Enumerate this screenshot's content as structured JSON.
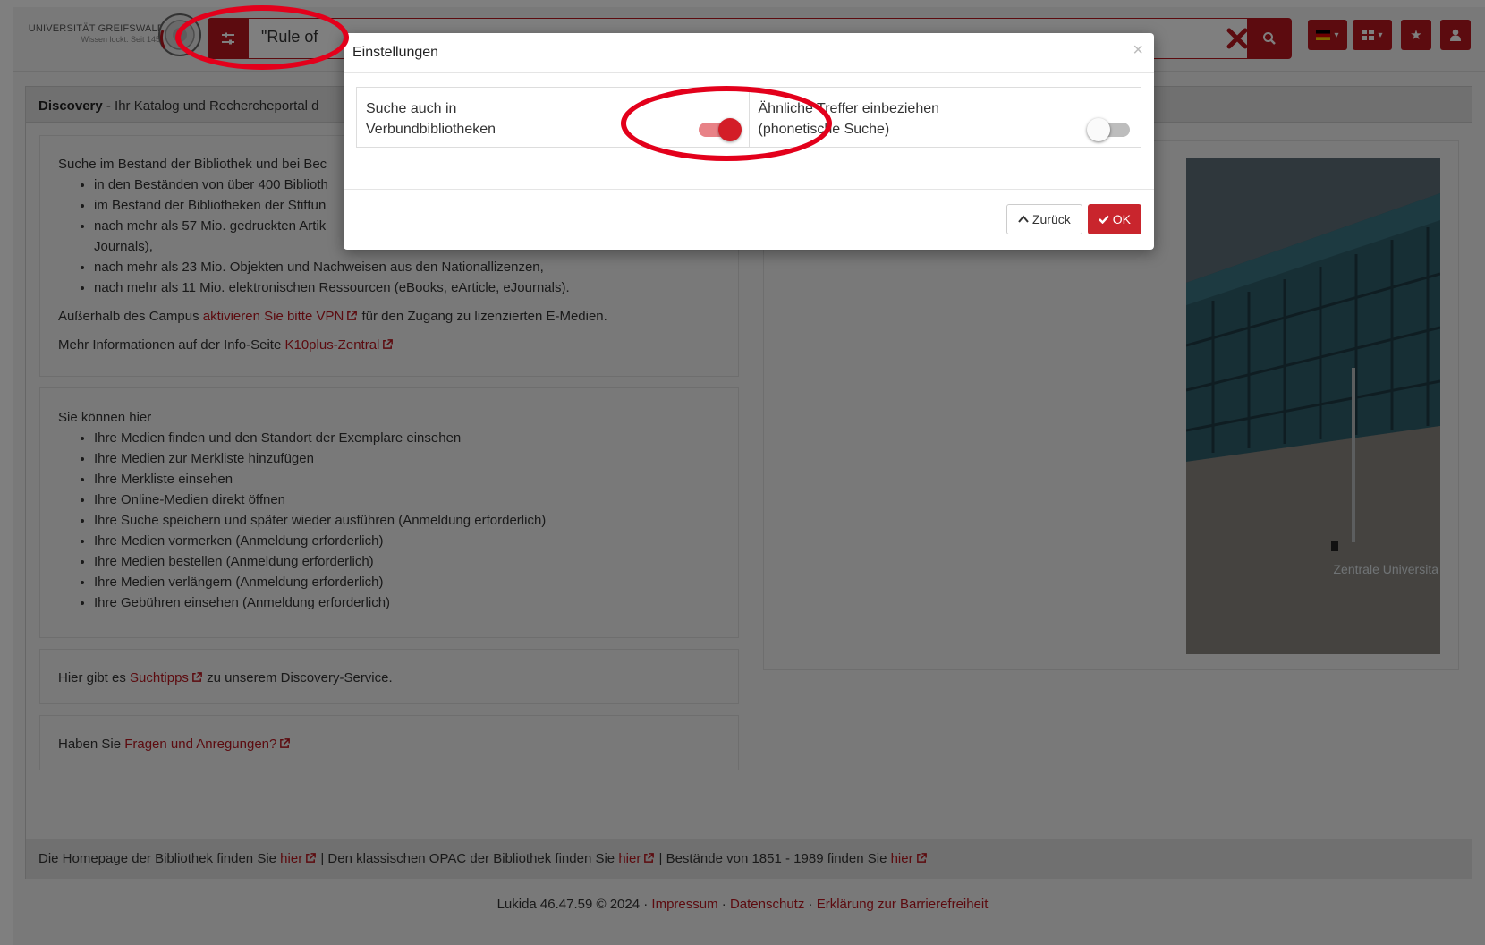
{
  "header": {
    "logo_title": "UNIVERSITÄT GREIFSWALD",
    "logo_subtitle": "Wissen lockt. Seit 1456",
    "search_value": "\"Rule of",
    "colors": {
      "accent": "#b8161f"
    }
  },
  "main": {
    "panel_title_bold": "Discovery",
    "panel_title_rest": " - Ihr Katalog und Rechercheportal d",
    "intro": {
      "lead": "Suche im Bestand der Bibliothek und bei Bec",
      "items": [
        "in den Beständen von über 400 Biblioth",
        "im Bestand der Bibliotheken der Stiftun",
        "nach mehr als 57 Mio. gedruckten Artik",
        "Journals),",
        "nach mehr als 23 Mio. Objekten und Nachweisen aus den Nationallizenzen,",
        "nach mehr als 11 Mio. elektronischen Ressourcen (eBooks, eArticle, eJournals)."
      ],
      "vpn_pre": "Außerhalb des Campus ",
      "vpn_link": "aktivieren Sie bitte VPN",
      "vpn_post": " für den Zugang zu lizenzierten E-Medien.",
      "info_pre": "Mehr Informationen auf der Info-Seite ",
      "info_link": "K10plus-Zentral"
    },
    "features": {
      "lead": "Sie können hier",
      "items": [
        "Ihre Medien finden und den Standort der Exemplare einsehen",
        "Ihre Medien zur Merkliste hinzufügen",
        "Ihre Merkliste einsehen",
        "Ihre Online-Medien direkt öffnen",
        "Ihre Suche speichern und später wieder ausführen (Anmeldung erforderlich)",
        "Ihre Medien vormerken (Anmeldung erforderlich)",
        "Ihre Medien bestellen (Anmeldung erforderlich)",
        "Ihre Medien verlängern (Anmeldung erforderlich)",
        "Ihre Gebühren einsehen (Anmeldung erforderlich)"
      ]
    },
    "tips_pre": "Hier gibt es ",
    "tips_link": "Suchtipps",
    "tips_post": " zu unserem Discovery-Service.",
    "questions_pre": "Haben Sie ",
    "questions_link": "Fragen und Anregungen?",
    "photo_caption": "Zentrale Universita",
    "footer": {
      "part1": "Die Homepage der Bibliothek finden Sie ",
      "link1": "hier",
      "part2": " | Den klassischen OPAC der Bibliothek finden Sie ",
      "link2": "hier",
      "part3": " | Bestände von 1851 - 1989 finden Sie ",
      "link3": "hier"
    }
  },
  "bottom": {
    "version": "Lukida 46.47.59 © 2024",
    "sep": " · ",
    "impressum": "Impressum",
    "datenschutz": "Datenschutz",
    "barriere": "Erklärung zur Barrierefreiheit"
  },
  "modal": {
    "title": "Einstellungen",
    "close": "×",
    "option1": {
      "label_line1": "Suche auch in",
      "label_line2": "Verbundbibliotheken",
      "enabled": true
    },
    "option2": {
      "label_line1": "Ähnliche Treffer einbeziehen",
      "label_line2": "(phonetische Suche)",
      "enabled": false
    },
    "back_label": "Zurück",
    "ok_label": "OK"
  }
}
